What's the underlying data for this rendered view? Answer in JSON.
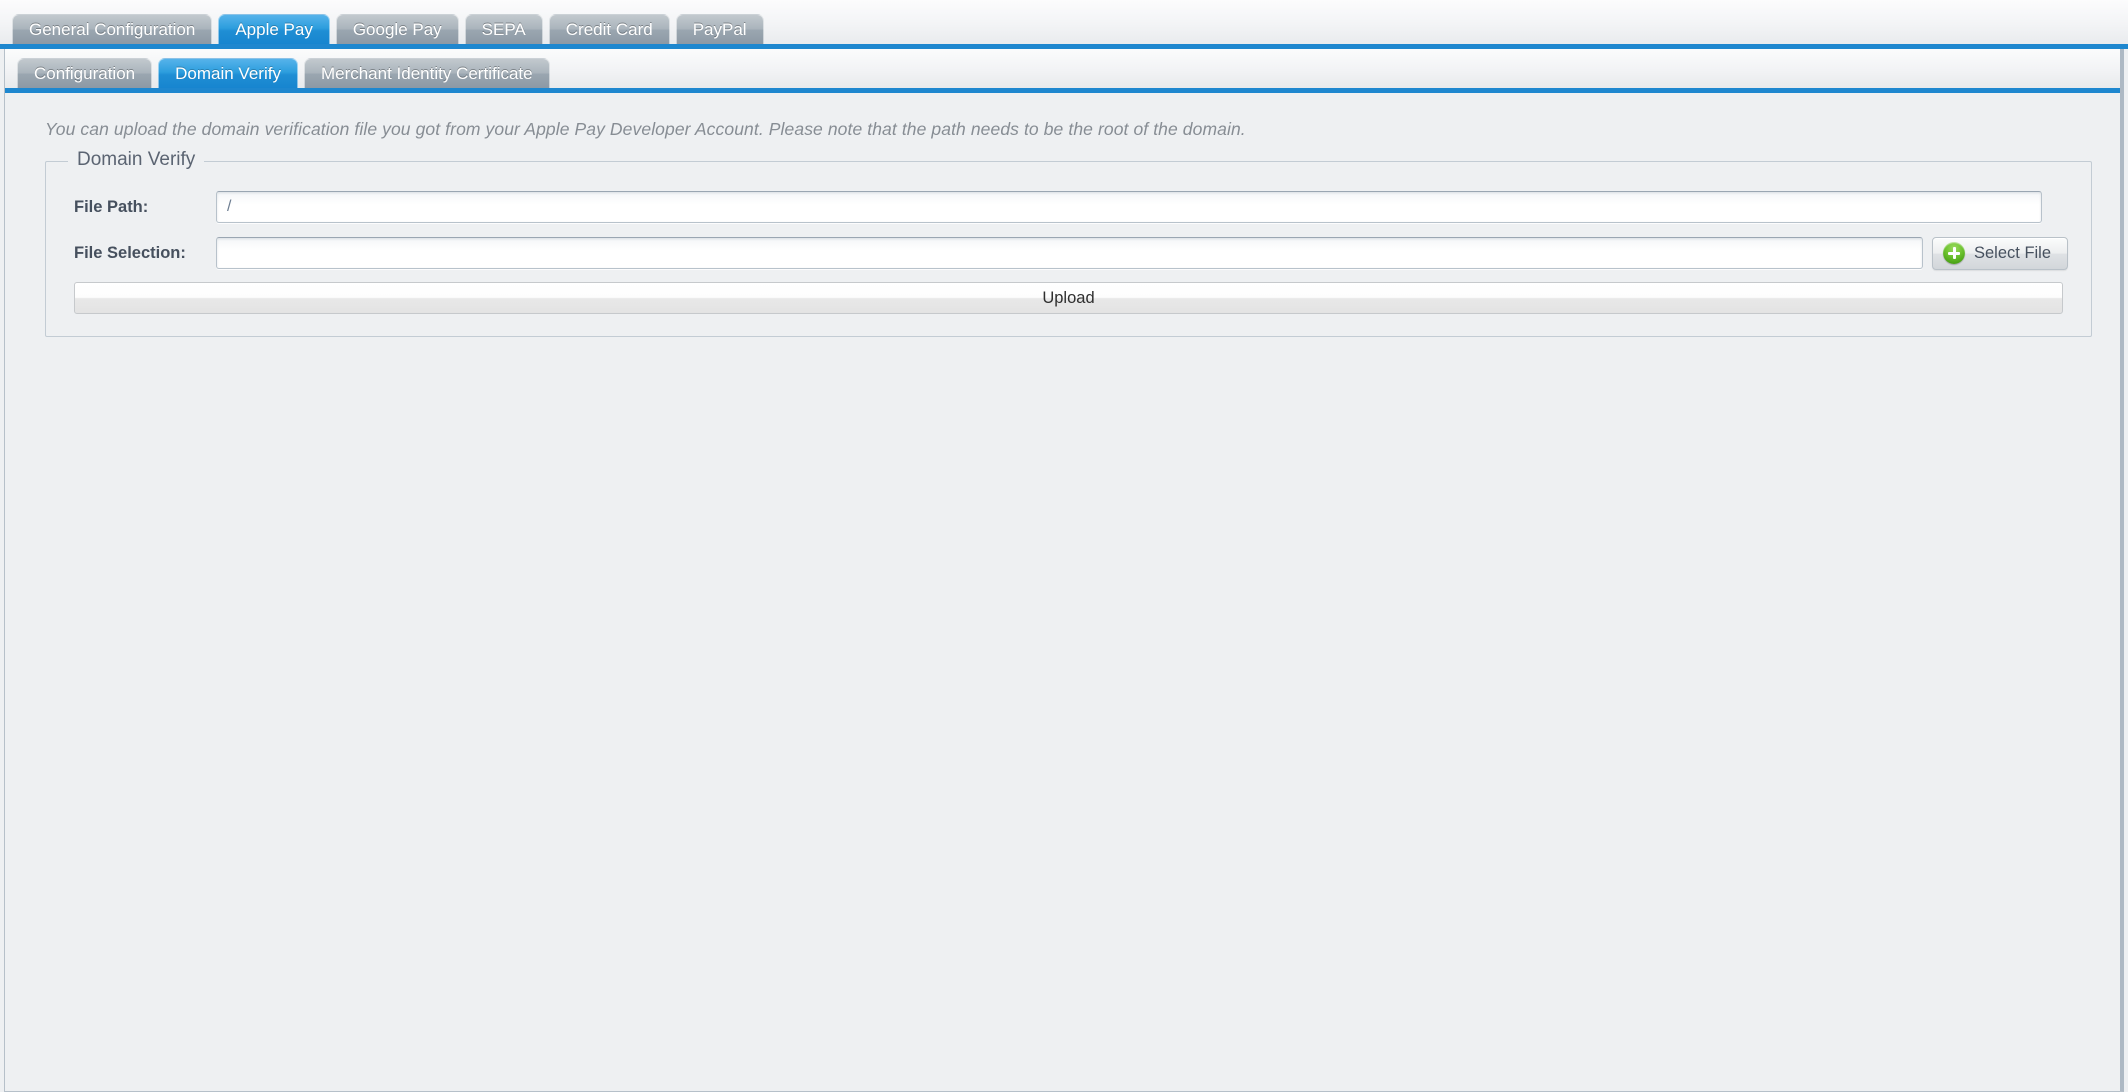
{
  "outer_tabs": [
    {
      "label": "General Configuration",
      "active": false
    },
    {
      "label": "Apple Pay",
      "active": true
    },
    {
      "label": "Google Pay",
      "active": false
    },
    {
      "label": "SEPA",
      "active": false
    },
    {
      "label": "Credit Card",
      "active": false
    },
    {
      "label": "PayPal",
      "active": false
    }
  ],
  "inner_tabs": [
    {
      "label": "Configuration",
      "active": false
    },
    {
      "label": "Domain Verify",
      "active": true
    },
    {
      "label": "Merchant Identity Certificate",
      "active": false
    }
  ],
  "content": {
    "intro": "You can upload the domain verification file you got from your Apple Pay Developer Account. Please note that the path needs to be the root of the domain.",
    "fieldset_legend": "Domain Verify",
    "file_path": {
      "label": "File Path:",
      "value": "/",
      "placeholder": "/"
    },
    "file_selection": {
      "label": "File Selection:",
      "value": "",
      "placeholder": ""
    },
    "select_file_button": "Select File",
    "select_file_icon": "green-plus-icon",
    "upload_button": "Upload"
  },
  "colors": {
    "accent_blue": "#1e87cf",
    "active_tab_blue": "#2d9ede",
    "inactive_tab_gray": "#9aa6b0",
    "page_background": "#eef0f2",
    "plus_icon_green": "#5cb82a",
    "label_text": "#46505e",
    "intro_text": "#878d94"
  }
}
